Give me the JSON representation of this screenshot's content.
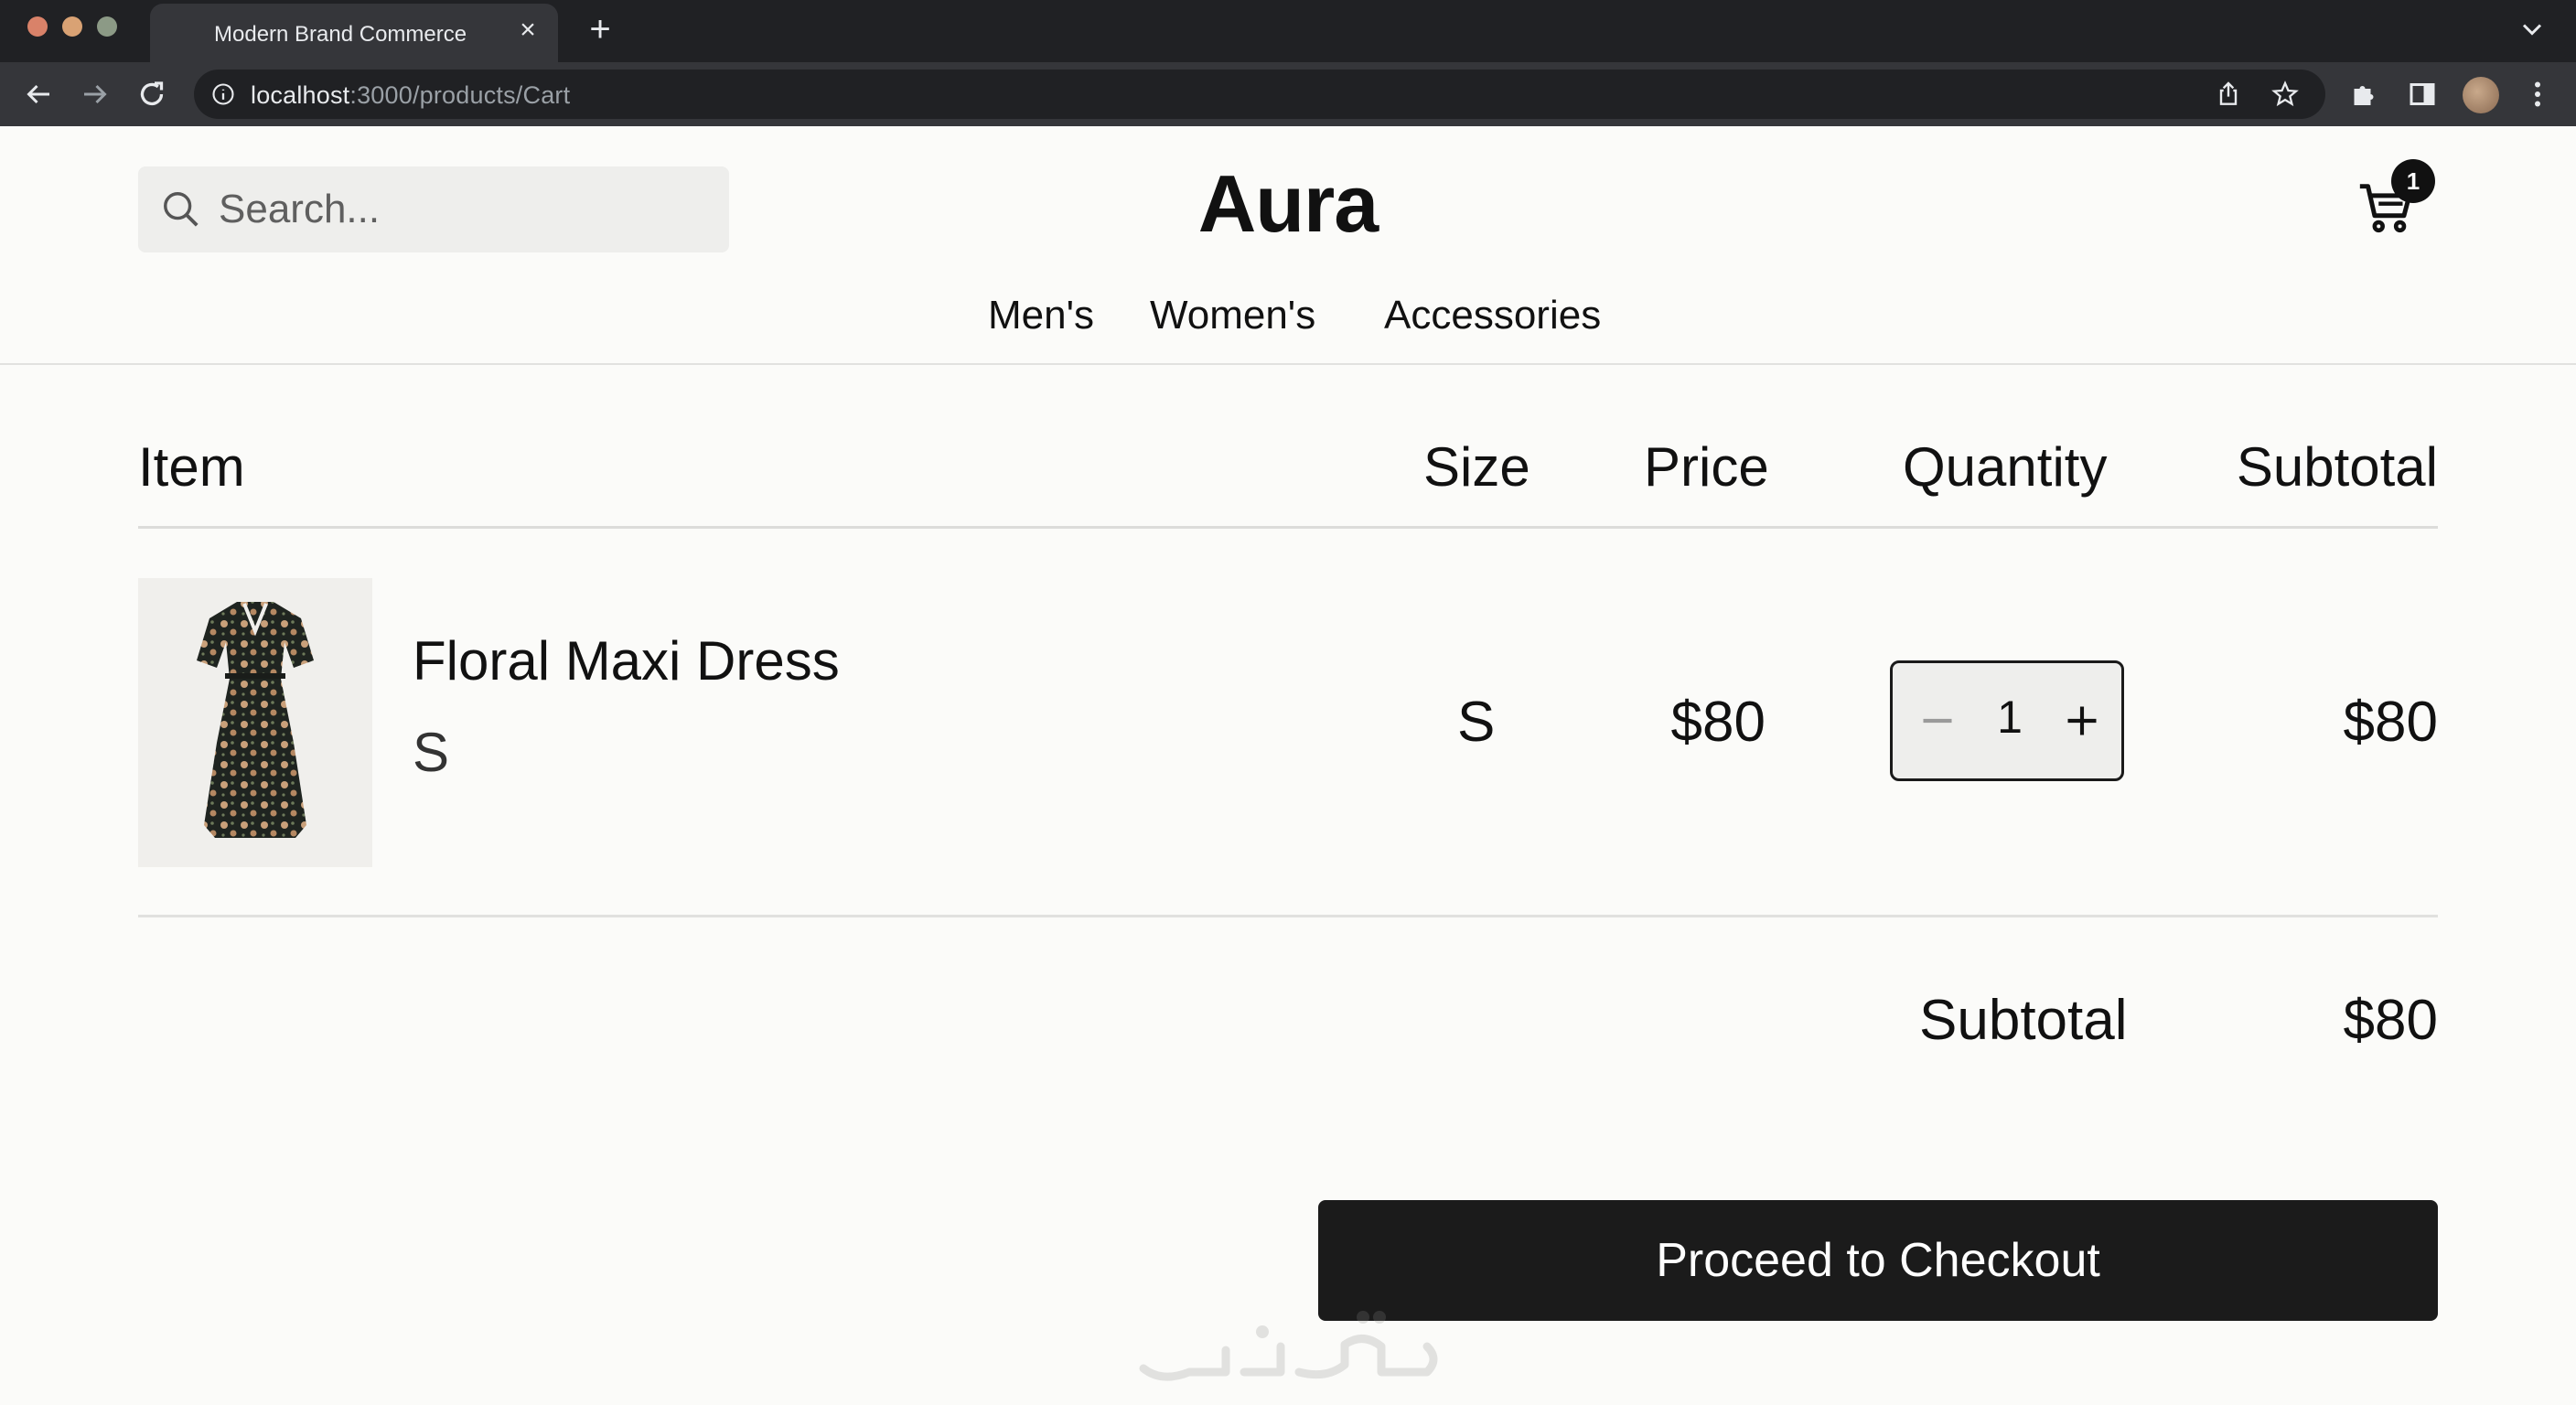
{
  "browser": {
    "tab_title": "Modern Brand Commerce",
    "url_host": "localhost",
    "url_path": ":3000/products/Cart"
  },
  "header": {
    "search_placeholder": "Search...",
    "brand": "Aura",
    "cart_count": "1",
    "nav": [
      "Men's",
      "Women's",
      "Accessories"
    ]
  },
  "cart": {
    "columns": [
      "Item",
      "Size",
      "Price",
      "Quantity",
      "Subtotal"
    ],
    "items": [
      {
        "name": "Floral Maxi Dress",
        "variant": "S",
        "size": "S",
        "price": "$80",
        "quantity": "1",
        "subtotal": "$80"
      }
    ]
  },
  "summary": {
    "label": "Subtotal",
    "value": "$80"
  },
  "checkout_label": "Proceed to Checkout",
  "colors": {
    "page_bg": "#fbfbf9",
    "button_bg": "#1b1b1b",
    "chrome_dark": "#202124"
  }
}
